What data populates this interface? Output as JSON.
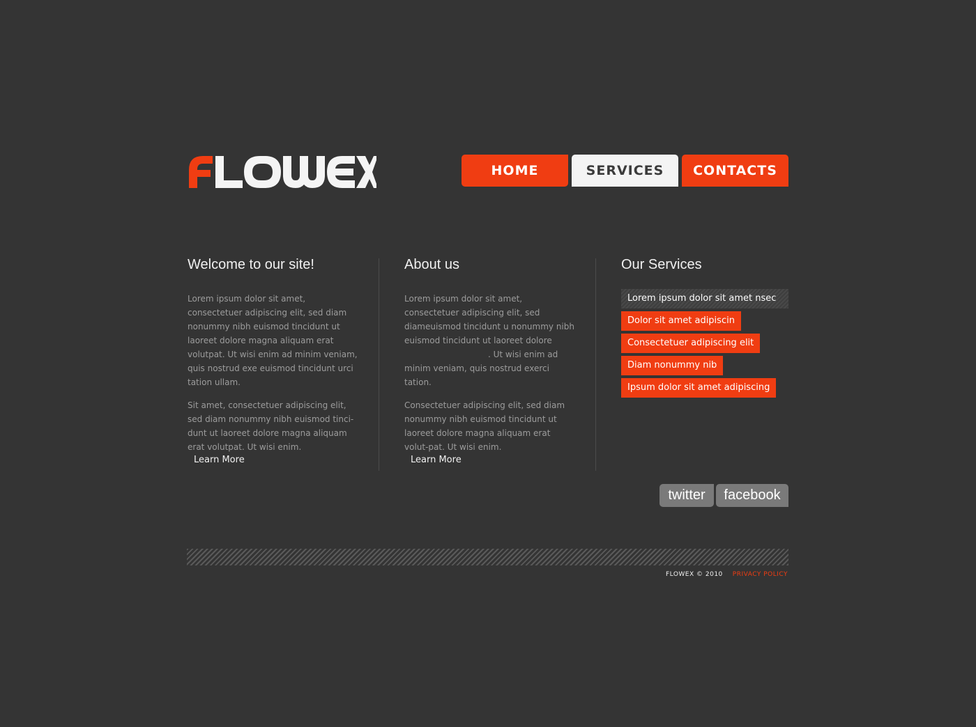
{
  "brand": {
    "logo_text": "FLOWEX",
    "accent_color": "#f03d12"
  },
  "nav": {
    "items": [
      {
        "label": "HOME"
      },
      {
        "label": "SERVICES"
      },
      {
        "label": "CONTACTS"
      }
    ]
  },
  "welcome": {
    "title": "Welcome to our site!",
    "p1": "Lorem ipsum dolor sit amet, consectetuer adipiscing elit, sed diam nonummy nibh euismod tincidunt ut laoreet dolore magna aliquam erat volutpat. Ut wisi enim ad minim veniam, quis nostrud exe euismod tincidunt urci tation ullam.",
    "p2": "Sit amet, consectetuer adipiscing elit, sed diam nonummy nibh euismod tinci-dunt ut laoreet dolore magna aliquam erat volutpat. Ut wisi enim.",
    "learn_more": "Learn More"
  },
  "about": {
    "title": "About us",
    "p1_a": "Lorem ipsum dolor sit amet, consectetuer adipiscing elit, sed diameuismod tincidunt u nonummy nibh euismod tincidunt ut laoreet dolore",
    "p1_b": ". Ut wisi enim ad minim veniam, quis nostrud exerci tation.",
    "p2": "Consectetuer adipiscing elit, sed diam nonummy nibh euismod tincidunt ut laoreet dolore magna aliquam erat volut-pat. Ut wisi enim.",
    "learn_more": "Learn More"
  },
  "services": {
    "title": "Our Services",
    "items": [
      {
        "label": "Lorem ipsum dolor sit amet nsec"
      },
      {
        "label": "Dolor sit amet adipiscin"
      },
      {
        "label": "Consectetuer adipiscing elit"
      },
      {
        "label": "Diam nonummy nib"
      },
      {
        "label": "Ipsum dolor sit amet adipiscing"
      }
    ]
  },
  "social": {
    "twitter": "twitter",
    "facebook": "facebook"
  },
  "footer": {
    "copyright": "FLOWEX © 2010",
    "privacy": "PRIVACY POLICY"
  }
}
